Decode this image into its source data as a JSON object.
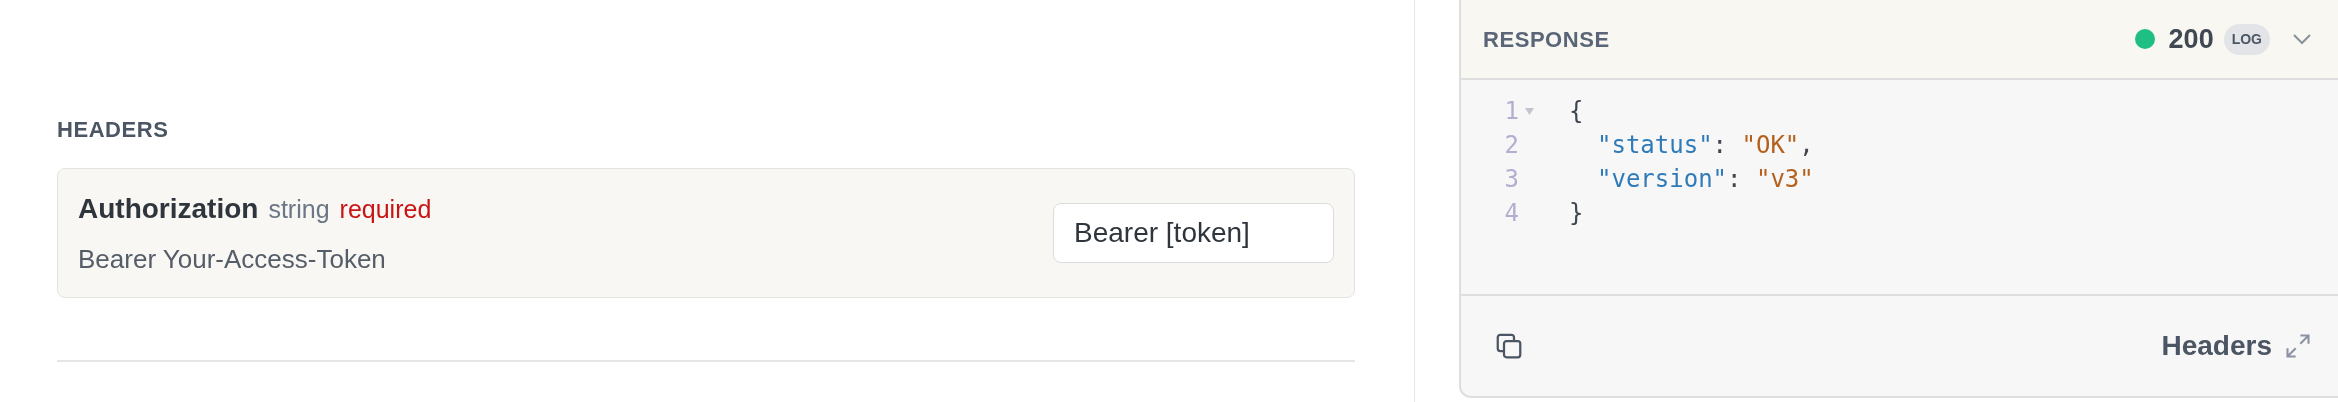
{
  "headers_section": {
    "title": "HEADERS",
    "params": [
      {
        "name": "Authorization",
        "type": "string",
        "required": true,
        "required_label": "required",
        "description": "Bearer Your-Access-Token",
        "value": "Bearer [token]"
      }
    ]
  },
  "response": {
    "title": "RESPONSE",
    "status": "200",
    "badge": "LOG",
    "expanded": false,
    "lines": [
      {
        "number": "1",
        "foldable": true,
        "tokens": [
          {
            "kind": "punct",
            "text": "{"
          }
        ],
        "children": [
          {
            "number": "2",
            "foldable": false,
            "tokens": [
              {
                "kind": "key",
                "text": "\"status\""
              },
              {
                "kind": "punct",
                "text": ": "
              },
              {
                "kind": "string",
                "text": "\"OK\""
              },
              {
                "kind": "punct",
                "text": ","
              }
            ]
          },
          {
            "number": "3",
            "foldable": false,
            "tokens": [
              {
                "kind": "key",
                "text": "\"version\""
              },
              {
                "kind": "punct",
                "text": ": "
              },
              {
                "kind": "string",
                "text": "\"v3\""
              }
            ]
          }
        ]
      },
      {
        "number": "4",
        "foldable": false,
        "tokens": [
          {
            "kind": "punct",
            "text": "}"
          }
        ]
      }
    ],
    "footer_label": "Headers"
  }
}
